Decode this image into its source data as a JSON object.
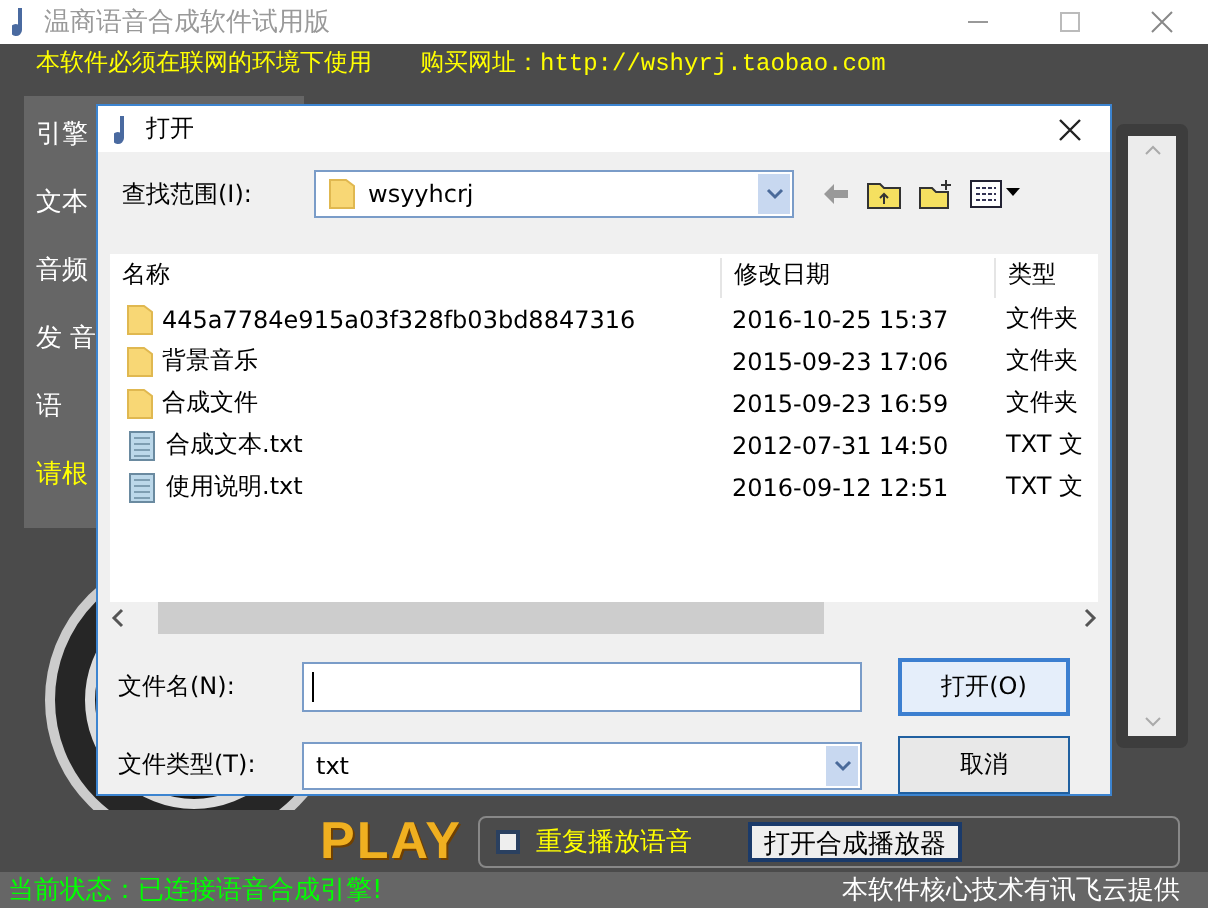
{
  "window": {
    "title": "温商语音合成软件试用版"
  },
  "notice": {
    "requirement": "本软件必须在联网的环境下使用",
    "shop": "购买网址：http://wshyrj.taobao.com"
  },
  "settings_labels": [
    {
      "text": "引擎",
      "kind": "label"
    },
    {
      "text": "文本",
      "kind": "label"
    },
    {
      "text": "音频",
      "kind": "label"
    },
    {
      "text": "发 音",
      "kind": "label"
    },
    {
      "text": "语",
      "kind": "label"
    },
    {
      "text": "请根",
      "kind": "hint"
    }
  ],
  "playback": {
    "logo": "PLAY",
    "repeat": {
      "label": "重复播放语音",
      "checked": false
    },
    "open_player": "打开合成播放器"
  },
  "status_bar": {
    "status": "当前状态：已连接语音合成引擎!",
    "credit": "本软件核心技术有讯飞云提供"
  },
  "dialog": {
    "title": "打开",
    "look_in": {
      "label": "查找范围(I):",
      "value": "wsyyhcrj"
    },
    "columns": [
      "名称",
      "修改日期",
      "类型"
    ],
    "files": [
      {
        "name": "445a7784e915a03f328fb03bd8847316",
        "modified": "2016-10-25 15:37",
        "type": "文件夹",
        "kind": "folder"
      },
      {
        "name": "背景音乐",
        "modified": "2015-09-23 17:06",
        "type": "文件夹",
        "kind": "folder"
      },
      {
        "name": "合成文件",
        "modified": "2015-09-23 16:59",
        "type": "文件夹",
        "kind": "folder"
      },
      {
        "name": "合成文本.txt",
        "modified": "2012-07-31 14:50",
        "type": "TXT 文",
        "kind": "text"
      },
      {
        "name": "使用说明.txt",
        "modified": "2016-09-12 12:51",
        "type": "TXT 文",
        "kind": "text"
      }
    ],
    "file_name": {
      "label": "文件名(N):"
    },
    "file_type": {
      "label": "文件类型(T):",
      "value": "txt"
    },
    "buttons": [
      {
        "label": "打开(O)",
        "default": true
      },
      {
        "label": "取消",
        "default": false
      }
    ]
  }
}
